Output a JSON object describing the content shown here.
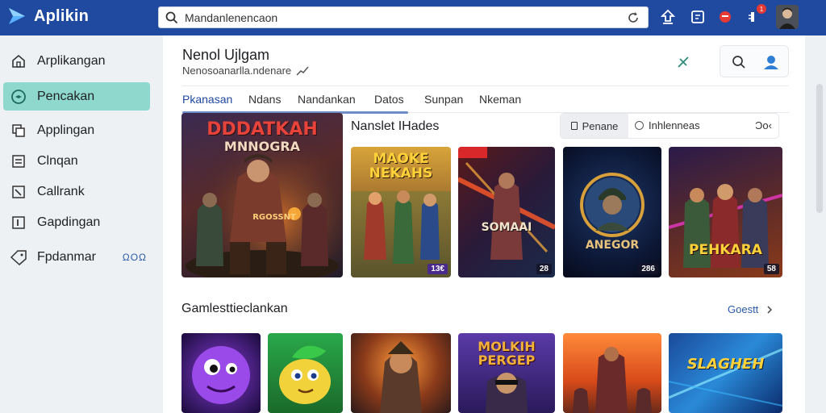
{
  "app": {
    "title": "Aplikin"
  },
  "search": {
    "placeholder": "Mandanlenencaon"
  },
  "topbar": {
    "notification_count": "1"
  },
  "sidebar": {
    "items": [
      {
        "label": "Arplikangan",
        "icon": "home-icon"
      },
      {
        "label": "Pencakan",
        "icon": "compass-icon",
        "active": true
      },
      {
        "label": "Applingan",
        "icon": "apps-icon"
      },
      {
        "label": "Clnqan",
        "icon": "list-icon"
      },
      {
        "label": "Callrank",
        "icon": "chart-icon"
      },
      {
        "label": "Gapdingan",
        "icon": "bookmark-icon"
      },
      {
        "label": "Fpdanmar",
        "icon": "tag-icon",
        "badge": "ΩOΩ"
      }
    ]
  },
  "main": {
    "title": "Nenol Ujlgam",
    "subtitle": "Nenosoanarlla.ndenare",
    "tabs": [
      {
        "label": "Pkanasan",
        "active": true
      },
      {
        "label": "Ndans"
      },
      {
        "label": "Nandankan"
      },
      {
        "label": "Datos"
      },
      {
        "label": "Sunpan"
      },
      {
        "label": "Nkeman"
      }
    ],
    "section1": {
      "title": "Nanslet IHades",
      "filter": {
        "chip": "Penane",
        "radio": "Inhlenneas",
        "more": "Ͻo‹"
      }
    },
    "section2": {
      "title": "Gamlesttieclankan",
      "see_more": "Goestt"
    },
    "featured": {
      "title_line1": "DDDATKAH",
      "title_line2": "MNNOGRA",
      "label": "RGOSSNT"
    },
    "cards_row1": [
      {
        "title": "MAOKE NEKAHS",
        "badge": "13€"
      },
      {
        "title": "SOMAAI",
        "badge": "28"
      },
      {
        "title": "ANEGOR",
        "badge": "286"
      },
      {
        "title": "PEHKARA",
        "badge": "58"
      }
    ],
    "cards_row2": [
      {
        "title": ""
      },
      {
        "title": ""
      },
      {
        "title": ""
      },
      {
        "title": "MOLKIH PERGEP"
      },
      {
        "title": ""
      },
      {
        "title": "SLAGHEH"
      }
    ]
  },
  "colors": {
    "topbar": "#1f4aa0",
    "active_nav": "#8ed8cd",
    "accent": "#1f4aa0"
  }
}
